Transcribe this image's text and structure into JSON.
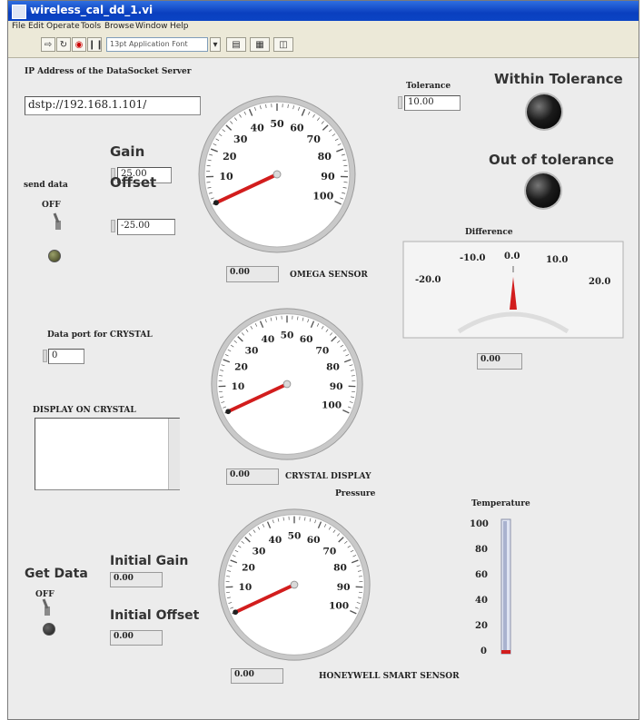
{
  "window": {
    "title": "wireless_cal_dd_1.vi"
  },
  "menu": [
    "File",
    "Edit",
    "Operate",
    "Tools",
    "Browse",
    "Window",
    "Help"
  ],
  "toolbar": {
    "font_select": "13pt Application Font"
  },
  "server": {
    "label": "IP Address of the DataSocket Server",
    "value": "dstp://192.168.1.101/"
  },
  "tolerance": {
    "label": "Tolerance",
    "value": "10.00"
  },
  "within_tolerance": {
    "label": "Within Tolerance"
  },
  "out_of_tolerance": {
    "label": "Out of tolerance"
  },
  "gain": {
    "label": "Gain",
    "value": "25.00"
  },
  "offset": {
    "label": "Offset",
    "value": "-25.00"
  },
  "send_data": {
    "label": "send data",
    "state": "OFF"
  },
  "omega": {
    "value": "0.00",
    "label": "OMEGA SENSOR"
  },
  "difference": {
    "label": "Difference",
    "value": "0.00",
    "ticks": [
      "-20.0",
      "-10.0",
      "0.0",
      "10.0",
      "20.0"
    ]
  },
  "data_port": {
    "label": "Data port for CRYSTAL",
    "value": "0"
  },
  "display_on_crystal": {
    "label": "DISPLAY ON CRYSTAL"
  },
  "crystal": {
    "value": "0.00",
    "label": "CRYSTAL DISPLAY"
  },
  "pressure": {
    "label": "Pressure"
  },
  "temperature": {
    "label": "Temperature",
    "ticks": [
      "100",
      "80",
      "60",
      "40",
      "20",
      "0"
    ]
  },
  "get_data": {
    "label": "Get Data",
    "state": "OFF"
  },
  "initial_gain": {
    "label": "Initial Gain",
    "value": "0.00"
  },
  "initial_offset": {
    "label": "Initial Offset",
    "value": "0.00"
  },
  "honeywell": {
    "value": "0.00",
    "label": "HONEYWELL SMART SENSOR"
  },
  "dial_ticks": [
    "10",
    "20",
    "30",
    "40",
    "50",
    "60",
    "70",
    "80",
    "90",
    "100"
  ],
  "colors": {
    "needle": "#d21d1d",
    "panel": "#ececec",
    "titlebar": "#0a3fbf"
  }
}
